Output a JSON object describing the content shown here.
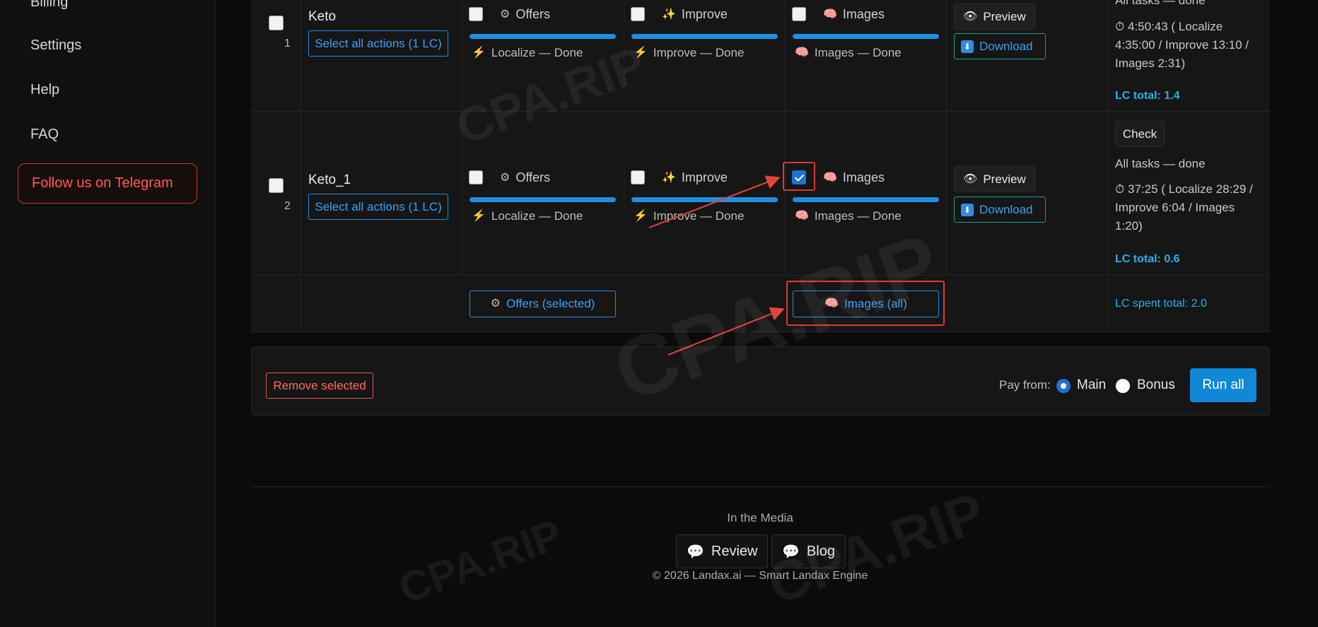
{
  "sidebar": {
    "items": [
      {
        "label": "Billing"
      },
      {
        "label": "Settings"
      },
      {
        "label": "Help"
      },
      {
        "label": "FAQ"
      }
    ],
    "telegram_label": "Follow us on Telegram"
  },
  "rows": [
    {
      "index": "1",
      "name": "Keto",
      "select_all_label": "Select all actions (1 LC)",
      "steps": [
        {
          "label": "Offers",
          "icon": "gear-icon",
          "status": "Localize — Done",
          "progress": 1.0
        },
        {
          "label": "Improve",
          "icon": "sparkles-icon",
          "status": "Improve — Done",
          "progress": 1.0
        },
        {
          "label": "Images",
          "icon": "brain-icon",
          "status": "Images — Done",
          "progress": 1.0
        }
      ],
      "preview_label": "Preview",
      "download_label": "Download",
      "summary_partial": "All tasks —  done",
      "timing": "4:50:43 ( Localize 4:35:00 /  Improve 13:10 /  Images 2:31)",
      "lc_total": "LC total: 1.4"
    },
    {
      "index": "2",
      "name": "Keto_1",
      "select_all_label": "Select all actions (1 LC)",
      "steps": [
        {
          "label": "Offers",
          "icon": "gear-icon",
          "status": "Localize — Done",
          "progress": 1.0
        },
        {
          "label": "Improve",
          "icon": "sparkles-icon",
          "status": "Improve — Done",
          "progress": 1.0
        },
        {
          "label": "Images",
          "icon": "brain-icon",
          "status": "Images — Done",
          "progress": 1.0,
          "checked": true
        }
      ],
      "preview_label": "Preview",
      "download_label": "Download",
      "check_label": "Check",
      "summary": "All tasks —  done",
      "timing": "37:25 ( Localize 28:29 /  Improve 6:04 /  Images 1:20)",
      "lc_total": "LC total: 0.6"
    }
  ],
  "totals_row": {
    "offers_btn": "Offers (selected)",
    "images_btn": "Images (all)",
    "lc_spent": "LC spent total: 2.0"
  },
  "controls": {
    "remove_label": "Remove selected",
    "pay_from": "Pay from:",
    "main_label": "Main",
    "bonus_label": "Bonus",
    "run_label": "Run all",
    "selected": "Main"
  },
  "footer": {
    "media_title": "In the Media",
    "review_label": "Review",
    "blog_label": "Blog",
    "copyright": "© 2026 Landax.ai — Smart Landax Engine"
  },
  "watermark": "CPA.RIP",
  "colors": {
    "accent": "#1e8fe0",
    "highlight": "#d93b31",
    "danger": "#ff5a50",
    "lc": "#23b2e8"
  }
}
